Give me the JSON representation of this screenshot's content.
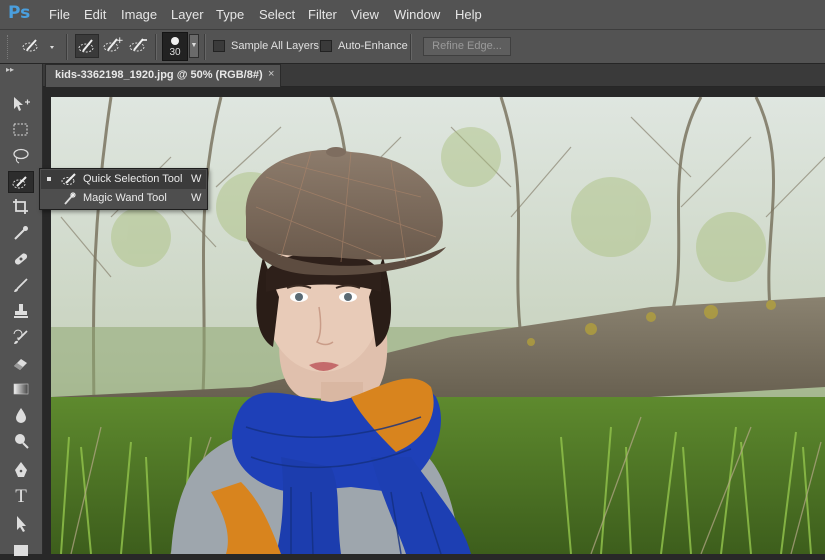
{
  "app": {
    "logo": "Ps"
  },
  "menu": {
    "items": [
      "File",
      "Edit",
      "Image",
      "Layer",
      "Type",
      "Select",
      "Filter",
      "View",
      "Window",
      "Help"
    ]
  },
  "options": {
    "brush_size": "30",
    "sample_all_layers": "Sample All Layers",
    "auto_enhance": "Auto-Enhance",
    "refine_edge": "Refine Edge..."
  },
  "document": {
    "tab_title": "kids-3362198_1920.jpg @ 50% (RGB/8#)",
    "close": "×"
  },
  "toolbar": {
    "collapse": "▸▸",
    "tools": [
      "move-tool",
      "marquee-tool",
      "lasso-tool",
      "quick-selection-tool",
      "crop-tool",
      "eyedropper-tool",
      "healing-brush-tool",
      "brush-tool",
      "clone-stamp-tool",
      "history-brush-tool",
      "eraser-tool",
      "gradient-tool",
      "blur-tool",
      "dodge-tool",
      "pen-tool",
      "type-tool",
      "path-selection-tool",
      "rectangle-tool"
    ],
    "type_tool_glyph": "T"
  },
  "flyout": {
    "items": [
      {
        "label": "Quick Selection Tool",
        "shortcut": "W",
        "selected": true
      },
      {
        "label": "Magic Wand Tool",
        "shortcut": "W",
        "selected": false
      }
    ]
  },
  "colors": {
    "ui": "#535353",
    "logo": "#4a9fde",
    "canvas_bg": "#282828"
  }
}
